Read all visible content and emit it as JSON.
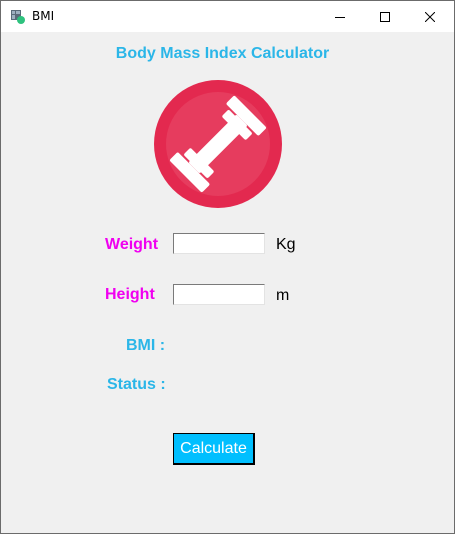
{
  "window": {
    "title": "BMI",
    "icon": "bmi-app-icon"
  },
  "colors": {
    "heading": "#2bb6e8",
    "input_label": "#f000f0",
    "result_label": "#2bb6e8",
    "button_bg": "#00bfff",
    "button_text": "#ffffff",
    "logo": "#e3294f",
    "background": "#f0f0f0"
  },
  "header": {
    "title": "Body Mass Index Calculator",
    "logo_icon": "dumbbell-icon"
  },
  "form": {
    "weight": {
      "label": "Weight",
      "value": "",
      "unit": "Kg"
    },
    "height": {
      "label": "Height",
      "value": "",
      "unit": "m"
    }
  },
  "results": {
    "bmi_label": "BMI :",
    "status_label": "Status :"
  },
  "actions": {
    "calculate_label": "Calculate"
  }
}
